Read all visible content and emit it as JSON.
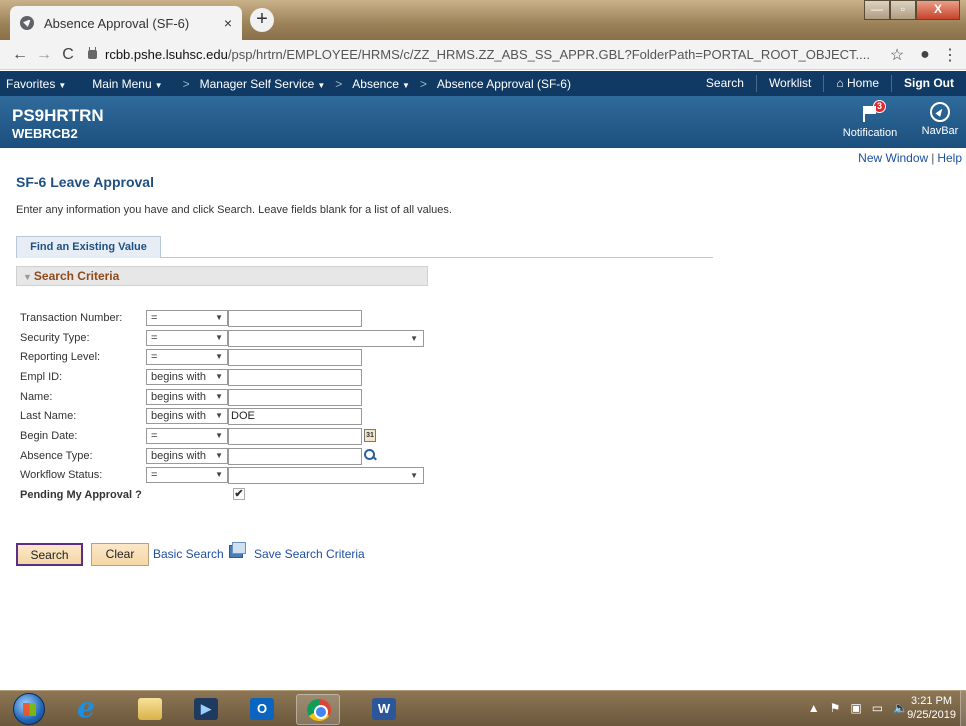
{
  "browser": {
    "tab_title": "Absence Approval (SF-6)",
    "tab_close": "×",
    "new_tab": "+",
    "url_host": "rcbb.pshe.lsuhsc.edu",
    "url_path": "/psp/hrtrn/EMPLOYEE/HRMS/c/ZZ_HRMS.ZZ_ABS_SS_APPR.GBL?FolderPath=PORTAL_ROOT_OBJECT....",
    "back": "←",
    "forward": "→",
    "reload": "C",
    "star": "☆",
    "account": "●",
    "menu": "⋮",
    "win_min": "—",
    "win_max": "▫",
    "win_close": "X"
  },
  "nav": {
    "favorites": "Favorites",
    "main_menu": "Main Menu",
    "breadcrumb": [
      "Manager Self Service",
      "Absence",
      "Absence Approval (SF-6)"
    ],
    "separator": ">",
    "search": "Search",
    "worklist": "Worklist",
    "home": "Home",
    "sign_out": "Sign Out"
  },
  "banner": {
    "database": "PS9HRTRN",
    "user": "WEBRCB2",
    "notification_label": "Notification",
    "notification_count": "3",
    "navbar_label": "NavBar"
  },
  "page": {
    "new_window": "New Window",
    "link_sep": "|",
    "help": "Help",
    "title": "SF-6 Leave Approval",
    "instructions": "Enter any information you have and click Search. Leave fields blank for a list of all values.",
    "tab_label": "Find an Existing Value",
    "criteria_header": "Search Criteria",
    "criteria_toggle": "▼"
  },
  "criteria": {
    "transaction_number": {
      "label": "Transaction Number:",
      "operator": "=",
      "value": ""
    },
    "security_type": {
      "label": "Security Type:",
      "operator": "=",
      "value": ""
    },
    "reporting_level": {
      "label": "Reporting Level:",
      "operator": "=",
      "value": ""
    },
    "empl_id": {
      "label": "Empl ID:",
      "operator": "begins with",
      "value": ""
    },
    "name": {
      "label": "Name:",
      "operator": "begins with",
      "value": ""
    },
    "last_name": {
      "label": "Last Name:",
      "operator": "begins with",
      "value": "DOE"
    },
    "begin_date": {
      "label": "Begin Date:",
      "operator": "=",
      "value": "",
      "calendar_text": "31"
    },
    "absence_type": {
      "label": "Absence Type:",
      "operator": "begins with",
      "value": ""
    },
    "workflow_status": {
      "label": "Workflow Status:",
      "operator": "=",
      "value": ""
    },
    "pending_approval": {
      "label": "Pending My Approval ?",
      "checked_mark": "✔"
    }
  },
  "actions": {
    "search": "Search",
    "clear": "Clear",
    "basic_search": "Basic Search",
    "save_search": "Save Search Criteria"
  },
  "taskbar": {
    "ie": "e",
    "word": "W",
    "outlook": "O",
    "media": "▶",
    "tray": [
      "▲",
      "⚑",
      "▣",
      "▭",
      "🔈"
    ],
    "time": "3:21 PM",
    "date": "9/25/2019"
  }
}
